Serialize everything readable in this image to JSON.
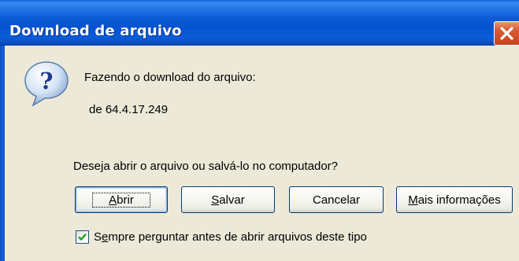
{
  "dialog": {
    "title": "Download de arquivo",
    "downloading_text": "Fazendo o download do arquivo:",
    "source_text": "de 64.4.17.249",
    "question_text": "Deseja abrir o arquivo ou salvá-lo no computador?"
  },
  "buttons": {
    "open": {
      "pre": "",
      "key": "A",
      "post": "brir"
    },
    "save": {
      "pre": "",
      "key": "S",
      "post": "alvar"
    },
    "cancel": {
      "label": "Cancelar"
    },
    "more_info": {
      "pre": "",
      "key": "M",
      "post": "ais informações"
    }
  },
  "checkbox": {
    "checked": true,
    "pre": "S",
    "key": "e",
    "post": "mpre perguntar antes de abrir arquivos deste tipo"
  },
  "icons": {
    "title_close": "close-icon",
    "prompt": "question-icon",
    "check": "checkmark-icon"
  },
  "colors": {
    "titlebar": "#0553CF",
    "close_button": "#DA5B34",
    "dialog_background": "#ECE9D8",
    "check": "#21A121"
  }
}
